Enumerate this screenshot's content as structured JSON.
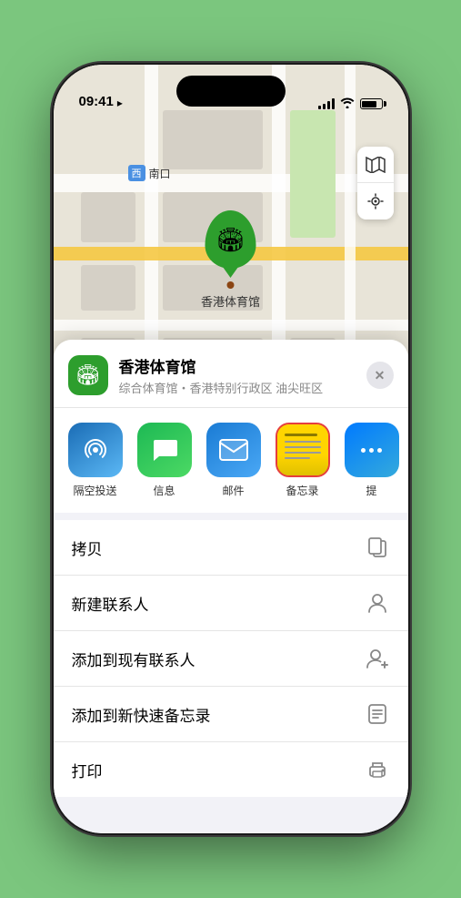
{
  "status_bar": {
    "time": "09:41",
    "location_arrow": "▶"
  },
  "map": {
    "label_badge": "西",
    "label_text": "南口",
    "map_icon": "🗺",
    "location_icon": "◎"
  },
  "pin": {
    "stadium_emoji": "🏟",
    "name": "香港体育馆"
  },
  "place_header": {
    "icon_emoji": "🏟",
    "name": "香港体育馆",
    "subtitle": "综合体育馆・香港特别行政区 油尖旺区",
    "close_label": "✕"
  },
  "share_items": [
    {
      "label": "隔空投送",
      "icon_class": "icon-airdrop",
      "icon": "📡"
    },
    {
      "label": "信息",
      "icon_class": "icon-messages",
      "icon": "💬"
    },
    {
      "label": "邮件",
      "icon_class": "icon-mail",
      "icon": "✉"
    },
    {
      "label": "备忘录",
      "icon_class": "icon-notes",
      "icon": "📝"
    },
    {
      "label": "提",
      "icon_class": "icon-more",
      "icon": "⋯"
    }
  ],
  "actions": [
    {
      "label": "拷贝",
      "icon": "copy"
    },
    {
      "label": "新建联系人",
      "icon": "person"
    },
    {
      "label": "添加到现有联系人",
      "icon": "person-add"
    },
    {
      "label": "添加到新快速备忘录",
      "icon": "note"
    },
    {
      "label": "打印",
      "icon": "print"
    }
  ]
}
